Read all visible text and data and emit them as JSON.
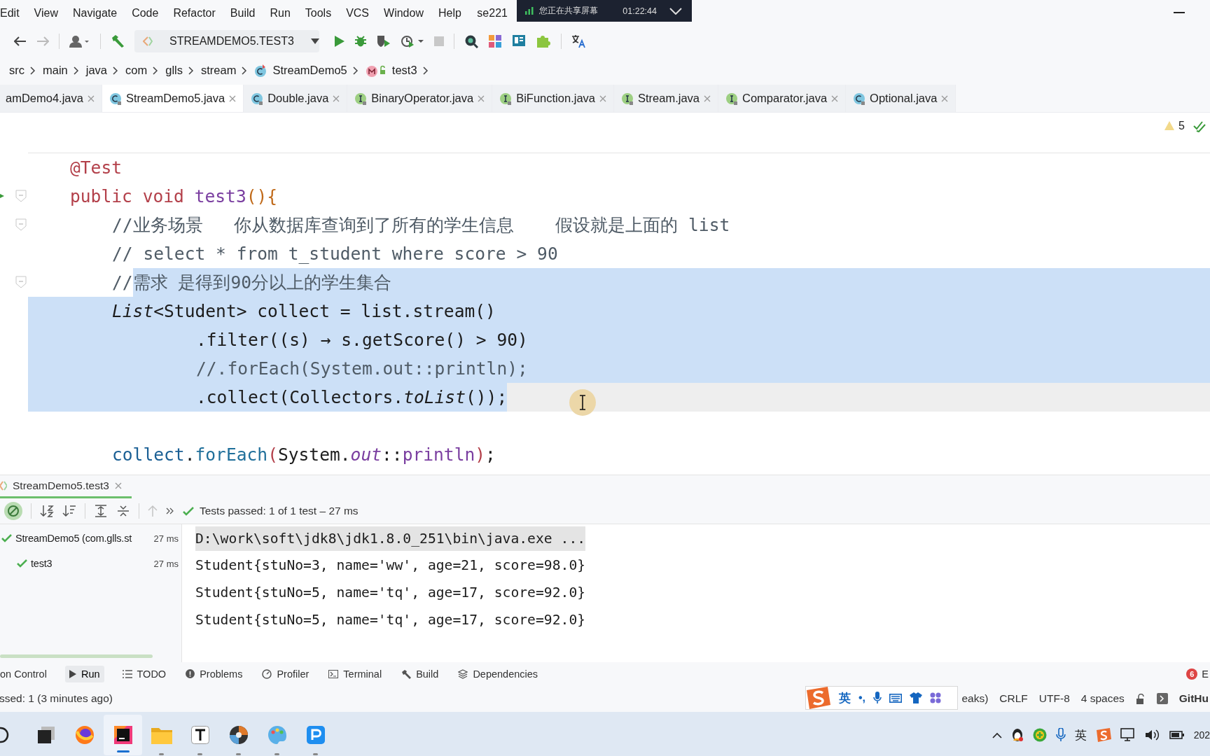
{
  "menu_bar": {
    "items": [
      "Edit",
      "View",
      "Navigate",
      "Code",
      "Refactor",
      "Build",
      "Run",
      "Tools",
      "VCS",
      "Window",
      "Help"
    ],
    "project_title": "se221"
  },
  "screen_share": {
    "text": "您正在共享屏幕",
    "time": "01:22:44"
  },
  "toolbar": {
    "run_config": "STREAMDEMO5.TEST3"
  },
  "breadcrumbs": [
    {
      "text": "src",
      "kind": "folder"
    },
    {
      "text": "main",
      "kind": "folder"
    },
    {
      "text": "java",
      "kind": "folder"
    },
    {
      "text": "com",
      "kind": "folder"
    },
    {
      "text": "glls",
      "kind": "folder"
    },
    {
      "text": "stream",
      "kind": "folder"
    },
    {
      "text": "StreamDemo5",
      "kind": "class"
    },
    {
      "text": "test3",
      "kind": "method"
    }
  ],
  "tabs": [
    {
      "label": "amDemo4.java",
      "kind": "cut",
      "selected": false
    },
    {
      "label": "StreamDemo5.java",
      "kind": "class",
      "selected": true
    },
    {
      "label": "Double.java",
      "kind": "class",
      "selected": false
    },
    {
      "label": "BinaryOperator.java",
      "kind": "interface",
      "selected": false
    },
    {
      "label": "BiFunction.java",
      "kind": "interface",
      "selected": false
    },
    {
      "label": "Stream.java",
      "kind": "interface",
      "selected": false
    },
    {
      "label": "Comparator.java",
      "kind": "interface",
      "selected": false
    },
    {
      "label": "Optional.java",
      "kind": "class",
      "selected": false
    }
  ],
  "editor": {
    "warnings": "5",
    "lines": [
      {
        "kind": "code",
        "fold_marker": false,
        "run_marker": false,
        "selected": false,
        "current": false,
        "tokens": [
          {
            "text": "@Test",
            "kind": "annotation"
          }
        ]
      },
      {
        "kind": "code",
        "fold_marker": true,
        "run_marker": true,
        "selected": false,
        "current": false,
        "tokens": [
          {
            "text": "public void ",
            "kind": "keyword"
          },
          {
            "text": "test3",
            "kind": "method"
          },
          {
            "text": "(){",
            "kind": "brace"
          }
        ],
        "children": [
          {
            "kind": "code",
            "fold_marker": true,
            "run_marker": false,
            "selected": false,
            "current": false,
            "tokens": [
              {
                "text": "//业务场景   你从数据库查询到了所有的学生信息    假设就是上面的 list",
                "kind": "comment"
              }
            ]
          },
          {
            "kind": "code",
            "fold_marker": false,
            "run_marker": false,
            "selected": false,
            "current": false,
            "tokens": [
              {
                "text": "// select * from t_student where score > 90",
                "kind": "comment"
              }
            ]
          },
          {
            "kind": "code",
            "fold_marker": true,
            "run_marker": false,
            "selected": true,
            "selection_begins_inside": true,
            "current": false,
            "tokens": [
              {
                "text": "//",
                "kind": "comment"
              },
              {
                "text": "需求 是得到90分以上的学生集合",
                "kind": "comment"
              }
            ]
          },
          {
            "kind": "code",
            "fold_marker": false,
            "run_marker": false,
            "selected": true,
            "current": false,
            "tokens": [
              {
                "text": "List",
                "kind": "italic"
              },
              {
                "text": "<Student> collect = list.stream()",
                "kind": "plain"
              }
            ],
            "children": [
              {
                "kind": "code",
                "fold_marker": false,
                "run_marker": false,
                "selected": true,
                "current": false,
                "tokens": [
                  {
                    "text": ".filter((s) → s.getScore() > 90)",
                    "kind": "plain"
                  }
                ]
              },
              {
                "kind": "code",
                "fold_marker": false,
                "run_marker": false,
                "selected": true,
                "current": false,
                "tokens": [
                  {
                    "text": "//.forEach(System.out::println);",
                    "kind": "comment"
                  }
                ]
              },
              {
                "kind": "code",
                "fold_marker": false,
                "run_marker": false,
                "selected": true,
                "current": true,
                "tokens": [
                  {
                    "text": ".collect(Collectors.",
                    "kind": "plain"
                  },
                  {
                    "text": "toList",
                    "kind": "italic"
                  },
                  {
                    "text": "());",
                    "kind": "plain"
                  }
                ]
              }
            ]
          },
          {
            "kind": "blank"
          },
          {
            "kind": "code",
            "fold_marker": false,
            "run_marker": false,
            "selected": false,
            "current": false,
            "tokens": [
              {
                "text": "collect",
                "kind": "variable"
              },
              {
                "text": ".",
                "kind": "plain"
              },
              {
                "text": "forEach",
                "kind": "call"
              },
              {
                "text": "(",
                "kind": "paren"
              },
              {
                "text": "System.",
                "kind": "plain"
              },
              {
                "text": "out",
                "kind": "static_field"
              },
              {
                "text": "::",
                "kind": "plain"
              },
              {
                "text": "println",
                "kind": "method"
              },
              {
                "text": ")",
                "kind": "paren"
              },
              {
                "text": ";",
                "kind": "plain"
              }
            ]
          }
        ]
      }
    ]
  },
  "run_panel": {
    "tab": "StreamDemo5.test3",
    "status": "Tests passed: 1 of 1 test – 27 ms",
    "tree": [
      {
        "label": "StreamDemo5 (com.glls.st",
        "time": "27 ms",
        "passed": true,
        "children": [
          {
            "label": "test3",
            "time": "27 ms",
            "passed": true
          }
        ]
      }
    ],
    "console": [
      {
        "text": "D:\\work\\soft\\jdk8\\jdk1.8.0_251\\bin\\java.exe ...",
        "kind": "command"
      },
      {
        "text": "Student{stuNo=3, name='ww', age=21, score=98.0}",
        "kind": "output"
      },
      {
        "text": "Student{stuNo=5, name='tq', age=17, score=92.0}",
        "kind": "output"
      },
      {
        "text": "Student{stuNo=5, name='tq', age=17, score=92.0}",
        "kind": "output"
      }
    ]
  },
  "tool_strip": {
    "items": [
      {
        "label": "on Control",
        "kind": "vcs",
        "selected": false
      },
      {
        "label": "Run",
        "kind": "run",
        "selected": true
      },
      {
        "label": "TODO",
        "kind": "todo",
        "selected": false
      },
      {
        "label": "Problems",
        "kind": "problems",
        "selected": false
      },
      {
        "label": "Profiler",
        "kind": "profiler",
        "selected": false
      },
      {
        "label": "Terminal",
        "kind": "terminal",
        "selected": false
      },
      {
        "label": "Build",
        "kind": "build",
        "selected": false
      },
      {
        "label": "Dependencies",
        "kind": "dependencies",
        "selected": false
      }
    ],
    "notification_count": "6",
    "notification_label": "E"
  },
  "status_bar": {
    "message": "ssed: 1 (3 minutes ago)",
    "items": [
      "eaks)",
      "CRLF",
      "UTF-8",
      "4 spaces"
    ],
    "tail": "GitHu"
  },
  "ime_bar": {
    "mode": "英",
    "punctuation": "•,"
  },
  "taskbar": {
    "apps": [
      {
        "kind": "search",
        "running": false,
        "active": false
      },
      {
        "kind": "taskview",
        "running": false,
        "active": false
      },
      {
        "kind": "browser",
        "running": false,
        "active": false
      },
      {
        "kind": "ide",
        "running": true,
        "active": true
      },
      {
        "kind": "folder",
        "running": true,
        "active": false
      },
      {
        "kind": "typora",
        "running": true,
        "active": false
      },
      {
        "kind": "disc",
        "running": true,
        "active": false
      },
      {
        "kind": "paint",
        "running": true,
        "active": false
      },
      {
        "kind": "viewer",
        "running": true,
        "active": false
      }
    ],
    "tray_ime": "英",
    "clock": "202"
  }
}
